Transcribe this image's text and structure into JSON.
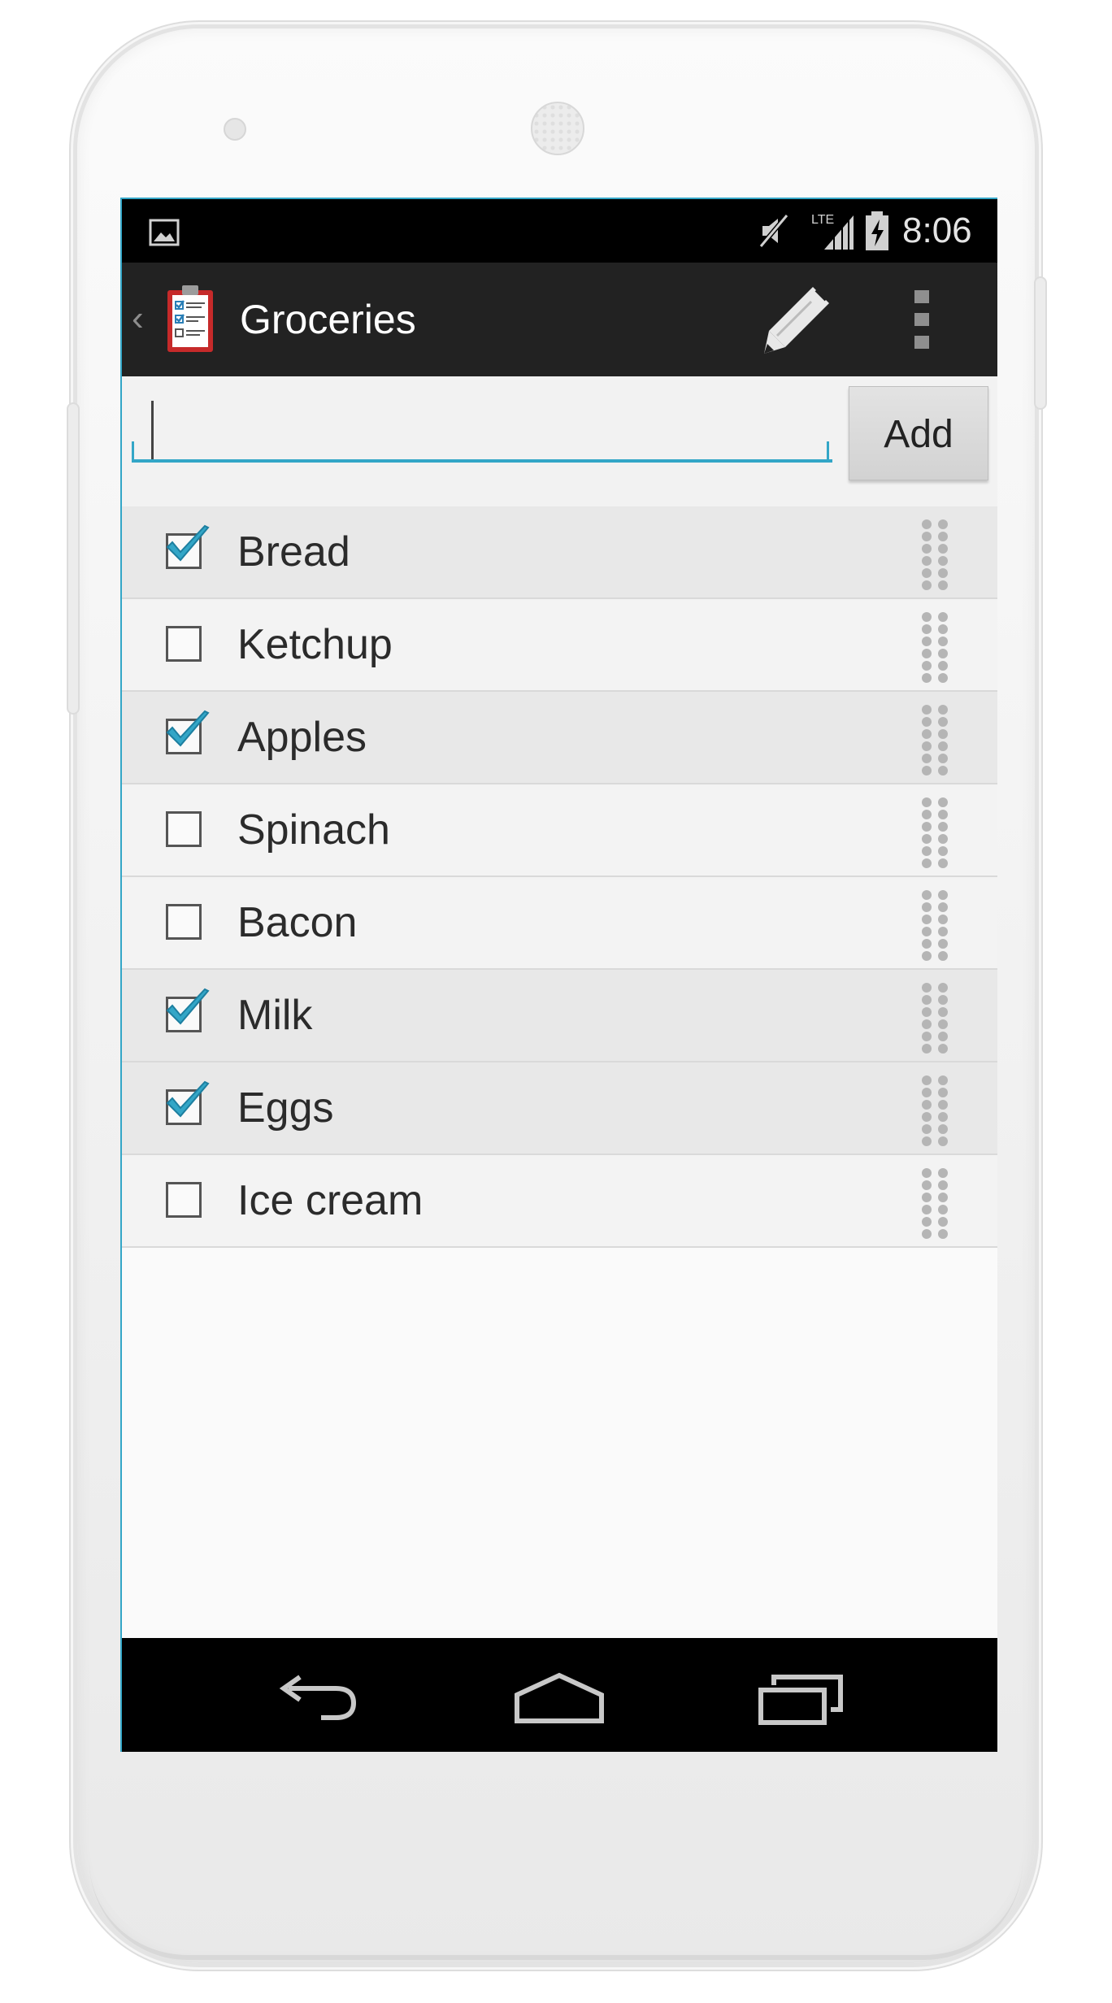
{
  "status_bar": {
    "time": "8:06",
    "icons": [
      "gallery-icon",
      "mute-icon",
      "lte-signal-icon",
      "battery-charging-icon"
    ],
    "network": "LTE"
  },
  "action_bar": {
    "app_icon": "clipboard-checklist-icon",
    "title": "Groceries",
    "actions": [
      "edit-pencil-icon",
      "overflow-menu-icon"
    ]
  },
  "input": {
    "value": "",
    "add_label": "Add"
  },
  "items": [
    {
      "label": "Bread",
      "checked": true
    },
    {
      "label": "Ketchup",
      "checked": false
    },
    {
      "label": "Apples",
      "checked": true
    },
    {
      "label": "Spinach",
      "checked": false
    },
    {
      "label": "Bacon",
      "checked": false
    },
    {
      "label": "Milk",
      "checked": true
    },
    {
      "label": "Eggs",
      "checked": true
    },
    {
      "label": "Ice cream",
      "checked": false
    }
  ],
  "nav_bar": {
    "buttons": [
      "back-icon",
      "home-icon",
      "recents-icon"
    ]
  },
  "colors": {
    "accent": "#33a6c7",
    "action_bar": "#222222",
    "checked_row": "#e8e8e8",
    "unchecked_row": "#f3f3f3"
  }
}
